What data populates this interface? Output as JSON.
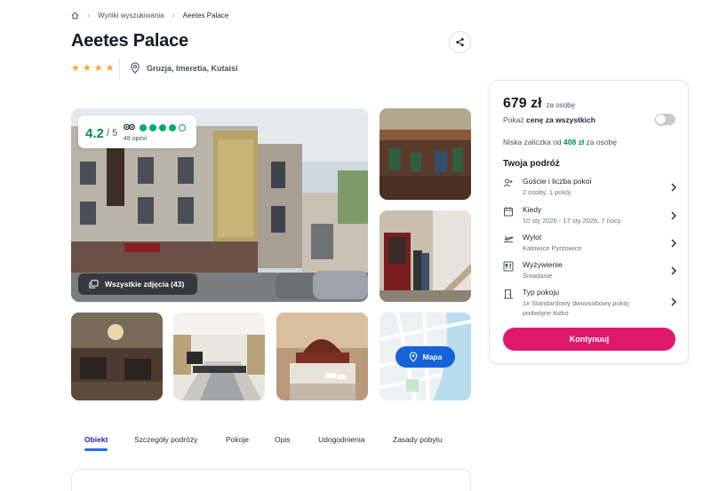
{
  "breadcrumb": {
    "items": [
      "Wyniki wyszukiwania",
      "Aeetes Palace"
    ]
  },
  "hotel": {
    "name": "Aeetes Palace",
    "stars": 4,
    "location": "Gruzja, Imeretia, Kutaisi"
  },
  "rating": {
    "score": "4.2",
    "out_of": "/ 5",
    "reviews": "48 opinii",
    "bubbles_filled": 4,
    "bubbles_total": 5
  },
  "gallery": {
    "all_photos_label": "Wszystkie zdjęcia (43)",
    "map_label": "Mapa"
  },
  "tabs": [
    "Obiekt",
    "Szczegóły podróży",
    "Pokoje",
    "Opis",
    "Udogodnienia",
    "Zasady pobytu"
  ],
  "booking": {
    "price": "679 zł",
    "price_per": "za osobę",
    "toggle_prefix": "Pokaż ",
    "toggle_bold": "cenę za wszystkich",
    "deposit_prefix": "Niska zaliczka od ",
    "deposit_amount": "408 zł",
    "deposit_suffix": " za osobę",
    "section_title": "Twoja podróż",
    "rows": [
      {
        "label": "Goście i liczba pokoi",
        "value": "2 osoby, 1 pokój"
      },
      {
        "label": "Kiedy",
        "value": "10 sty 2026 - 17 sty 2026, 7 nocy"
      },
      {
        "label": "Wylot",
        "value": "Katowice Pyrzowice"
      },
      {
        "label": "Wyżywienie",
        "value": "Śniadanie"
      },
      {
        "label": "Typ pokoju",
        "value": "1x Standardowy dwuosobowy pokój podwójne łóżko"
      }
    ],
    "continue_label": "Kontynuuj"
  },
  "colors": {
    "accent": "#e0186c",
    "primary_blue": "#1762d6",
    "rating_green": "#0b8a4e",
    "star": "#f4a62a"
  }
}
